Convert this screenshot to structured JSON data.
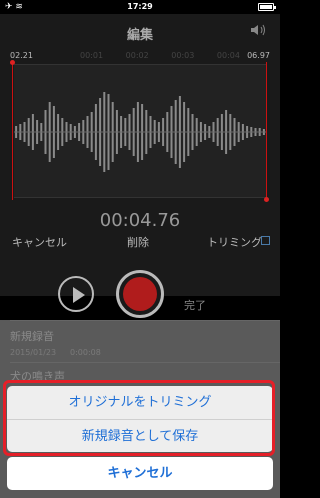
{
  "status_bar": {
    "left": "✈ ≋",
    "time": "17:29"
  },
  "nav": {
    "title": "編集"
  },
  "timeline": {
    "start": "02.21",
    "end": "06.97",
    "ticks": [
      "00:01",
      "00:02",
      "00:03",
      "00:04"
    ]
  },
  "elapsed": "00:04.76",
  "toolbar": {
    "cancel": "キャンセル",
    "delete": "削除",
    "trim": "トリミング"
  },
  "controls": {
    "done": "完了"
  },
  "list": [
    {
      "title": "新規録音",
      "date": "2015/01/23",
      "duration": "0:00:08"
    },
    {
      "title": "犬の鳴き声"
    }
  ],
  "action_sheet": {
    "trim_original": "オリジナルをトリミング",
    "save_as_new": "新規録音として保存",
    "cancel": "キャンセル"
  },
  "colors": {
    "accent": "#1f6fd6",
    "highlight": "#e51f28",
    "record": "#b01c1c"
  }
}
